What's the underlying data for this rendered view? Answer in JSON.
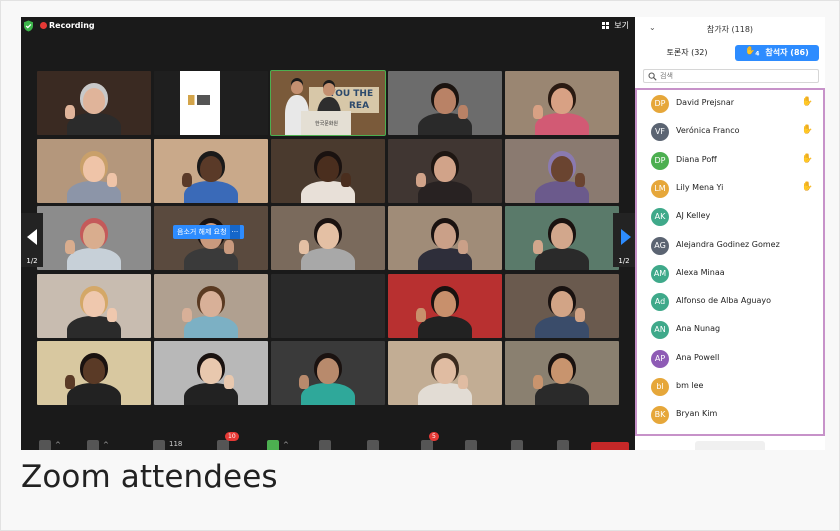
{
  "meeting": {
    "recording_label": "Recording",
    "view_label": "보기",
    "page_left": "1/2",
    "page_right": "1/2",
    "request_badge": {
      "label": "음소거 해제 요청",
      "more": "···"
    },
    "banner_text": "YOU THE",
    "banner_text2": "REA",
    "logo_text": "한국문화원"
  },
  "toolbar": {
    "participants_count": "118",
    "chat_badge": "10",
    "reactions_badge": "5"
  },
  "panel": {
    "title": "참가자 (118)",
    "tabs": {
      "panelists": "토론자 (32)",
      "attendees": "참석자 (86)",
      "attendees_hand_count": "4"
    },
    "search_placeholder": "검색",
    "attendees": [
      {
        "initials": "DP",
        "name": "David Prejsnar",
        "color": "#e6a73a",
        "hand": true
      },
      {
        "initials": "VF",
        "name": "Verónica Franco",
        "color": "#5b6472",
        "hand": true
      },
      {
        "initials": "DP",
        "name": "Diana Poff",
        "color": "#4caf50",
        "hand": true
      },
      {
        "initials": "LM",
        "name": "Lily Mena Yi",
        "color": "#e6a73a",
        "hand": true
      },
      {
        "initials": "AK",
        "name": "AJ Kelley",
        "color": "#3fa98a",
        "hand": false
      },
      {
        "initials": "AG",
        "name": "Alejandra Godinez Gomez",
        "color": "#5b6472",
        "hand": false
      },
      {
        "initials": "AM",
        "name": "Alexa Minaa",
        "color": "#3fa98a",
        "hand": false
      },
      {
        "initials": "Ad",
        "name": "Alfonso de Alba Aguayo",
        "color": "#3fa98a",
        "hand": false
      },
      {
        "initials": "AN",
        "name": "Ana Nunag",
        "color": "#3fa98a",
        "hand": false
      },
      {
        "initials": "AP",
        "name": "Ana Powell",
        "color": "#8e5bb5",
        "hand": false
      },
      {
        "initials": "bl",
        "name": "bm lee",
        "color": "#e6a73a",
        "hand": false
      },
      {
        "initials": "BK",
        "name": "Bryan Kim",
        "color": "#e6a73a",
        "hand": false
      }
    ]
  },
  "caption": "Zoom attendees",
  "tiles": [
    {
      "wall": "#3a2a22",
      "skin": "#e0b49a",
      "shirt": "#2b2b2b",
      "hair": "#c8c8c8"
    },
    {
      "wall": "#ffffff",
      "skin": "#ffffff",
      "shirt": "#ffffff",
      "hair": "#ffffff",
      "logo": true
    },
    {
      "wall": "#7a5a3a",
      "skin": "#c49070",
      "shirt": "#e7e0d2",
      "hair": "#1d1d1d",
      "stage": true
    },
    {
      "wall": "#6c6c6c",
      "skin": "#b98266",
      "shirt": "#2a2a2a",
      "hair": "#1b1410"
    },
    {
      "wall": "#9a8672",
      "skin": "#d8a184",
      "shirt": "#d25a74",
      "hair": "#2a1a12"
    },
    {
      "wall": "#b4977c",
      "skin": "#efc4a8",
      "shirt": "#8c95a8",
      "hair": "#c9a06a"
    },
    {
      "wall": "#c9a98a",
      "skin": "#5a3a28",
      "shirt": "#3a6ab8",
      "hair": "#1a1a1a"
    },
    {
      "wall": "#4a3a2e",
      "skin": "#4a2e1e",
      "shirt": "#e8e0d8",
      "hair": "#1a1210"
    },
    {
      "wall": "#403632",
      "skin": "#d1a389",
      "shirt": "#282222",
      "hair": "#1e1612"
    },
    {
      "wall": "#8a7a70",
      "skin": "#6a4430",
      "shirt": "#6b5a8c",
      "hair": "#8a7ab0"
    },
    {
      "wall": "#8c8c8c",
      "skin": "#d9ad8e",
      "shirt": "#c7d0d8",
      "hair": "#c45a5a"
    },
    {
      "wall": "#5a4a3e",
      "skin": "#c99a7e",
      "shirt": "#3a3a3a",
      "hair": "#1a1210"
    },
    {
      "wall": "#7a6a5c",
      "skin": "#e4c0a4",
      "shirt": "#a8a8a8",
      "hair": "#1a1210"
    },
    {
      "wall": "#a08c78",
      "skin": "#caa088",
      "shirt": "#2e2e3a",
      "hair": "#1a1210"
    },
    {
      "wall": "#5a7a6a",
      "skin": "#d2a78c",
      "shirt": "#2a2a2a",
      "hair": "#1a1210"
    },
    {
      "wall": "#c8bcb0",
      "skin": "#efc8ae",
      "shirt": "#2b2b2b",
      "hair": "#d4a868"
    },
    {
      "wall": "#b0a090",
      "skin": "#d8b098",
      "shirt": "#7cb0c4",
      "hair": "#5a3a22"
    },
    {
      "wall": "#2a2a2a",
      "skin": "#2a2a2a",
      "shirt": "#2a2a2a",
      "hair": "#2a2a2a",
      "empty": true
    },
    {
      "wall": "#b83030",
      "skin": "#c8906c",
      "shirt": "#222222",
      "hair": "#1a1210"
    },
    {
      "wall": "#6a5a4e",
      "skin": "#d2a486",
      "shirt": "#3a4c6a",
      "hair": "#1a1210"
    },
    {
      "wall": "#d8c8a0",
      "skin": "#5a3a26",
      "shirt": "#222222",
      "hair": "#1a1210"
    },
    {
      "wall": "#b8b8b8",
      "skin": "#e8c8ae",
      "shirt": "#222222",
      "hair": "#1a1210"
    },
    {
      "wall": "#3a3a3a",
      "skin": "#b88a6c",
      "shirt": "#2fa89a",
      "hair": "#1a1210"
    },
    {
      "wall": "#c2ad94",
      "skin": "#e0bca2",
      "shirt": "#e2dcd4",
      "hair": "#3a2a1e"
    },
    {
      "wall": "#8a8070",
      "skin": "#c8946e",
      "shirt": "#2a2a2a",
      "hair": "#1a1210"
    }
  ]
}
